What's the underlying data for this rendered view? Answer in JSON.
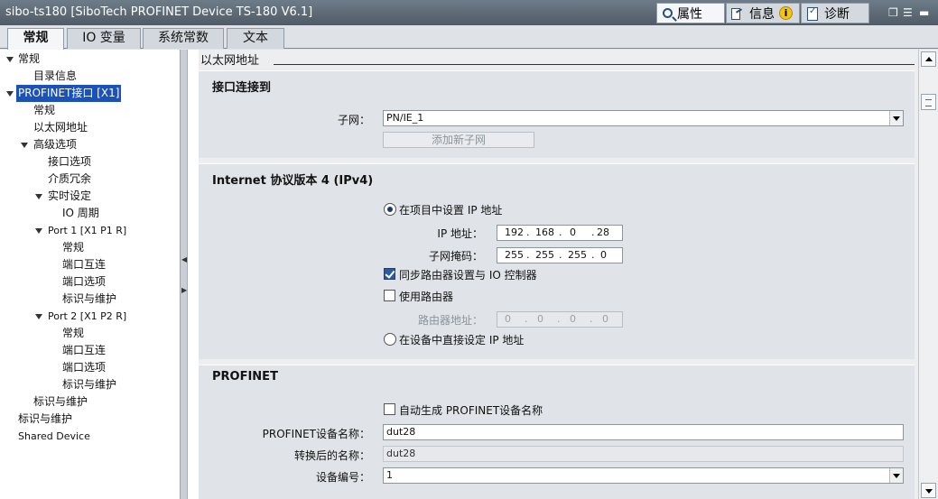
{
  "window": {
    "title": "sibo-ts180 [SiboTech PROFINET Device TS-180 V6.1]",
    "right_tabs": [
      {
        "label": "属性",
        "active": true
      },
      {
        "label": "信息",
        "active": false,
        "badge": "i"
      },
      {
        "label": "诊断",
        "active": false
      }
    ]
  },
  "tabs": [
    {
      "label": "常规",
      "active": true
    },
    {
      "label": "IO 变量",
      "active": false
    },
    {
      "label": "系统常数",
      "active": false
    },
    {
      "label": "文本",
      "active": false
    }
  ],
  "tree": [
    {
      "label": "常规",
      "expanded": true
    },
    {
      "label": "目录信息"
    },
    {
      "label": "PROFINET接口 [X1]",
      "expanded": true,
      "selected": true
    },
    {
      "label": "常规"
    },
    {
      "label": "以太网地址"
    },
    {
      "label": "高级选项",
      "expanded": true
    },
    {
      "label": "接口选项"
    },
    {
      "label": "介质冗余"
    },
    {
      "label": "实时设定",
      "expanded": true
    },
    {
      "label": "IO 周期"
    },
    {
      "label": "Port 1 [X1 P1 R]",
      "expanded": true
    },
    {
      "label": "常规"
    },
    {
      "label": "端口互连"
    },
    {
      "label": "端口选项"
    },
    {
      "label": "标识与维护"
    },
    {
      "label": "Port 2 [X1 P2 R]",
      "expanded": true
    },
    {
      "label": "常规"
    },
    {
      "label": "端口互连"
    },
    {
      "label": "端口选项"
    },
    {
      "label": "标识与维护"
    },
    {
      "label": "标识与维护"
    },
    {
      "label": "标识与维护"
    },
    {
      "label": "Shared Device"
    }
  ],
  "breadcrumb": "以太网地址",
  "interface_section": {
    "title": "接口连接到",
    "subnet_label": "子网：",
    "subnet_value": "PN/IE_1",
    "add_subnet_button": "添加新子网"
  },
  "ipv4_section": {
    "title": "Internet 协议版本 4 (IPv4)",
    "option_project": "在项目中设置 IP 地址",
    "ip_label": "IP 地址：",
    "ip_octets": [
      "192",
      "168",
      "0",
      "28"
    ],
    "mask_label": "子网掩码：",
    "mask_octets": [
      "255",
      "255",
      "255",
      "0"
    ],
    "sync_router": "同步路由器设置与 IO 控制器",
    "use_router": "使用路由器",
    "router_label": "路由器地址：",
    "router_octets": [
      "0",
      "0",
      "0",
      "0"
    ],
    "option_device": "在设备中直接设定 IP 地址",
    "state": {
      "project_selected": true,
      "sync_router_checked": true,
      "use_router_checked": false
    }
  },
  "profinet_section": {
    "title": "PROFINET",
    "auto_generate": "自动生成 PROFINET设备名称",
    "auto_generate_checked": false,
    "device_name_label": "PROFINET设备名称：",
    "device_name": "dut28",
    "converted_label": "转换后的名称：",
    "converted_name": "dut28",
    "device_number_label": "设备编号：",
    "device_number": "1"
  }
}
